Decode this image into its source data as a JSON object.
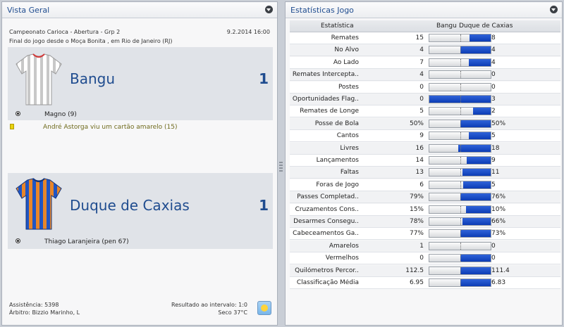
{
  "overview": {
    "title": "Vista Geral",
    "competition": "Campeonato Carioca - Abertura - Grp 2",
    "datetime": "9.2.2014 16:00",
    "venue": "Final do jogo desde o Moça Bonita , em Rio de Janeiro (RJ)",
    "home": {
      "name": "Bangu",
      "score": "1",
      "kit_colors": [
        "#ffffff",
        "#c9c9c9"
      ],
      "events": [
        {
          "icon": "ball-icon",
          "text": "Magno (9)"
        },
        {
          "icon": "yellow-card-icon",
          "text": "André Astorga viu um cartão amarelo (15)"
        }
      ]
    },
    "away": {
      "name": "Duque de Caxias",
      "score": "1",
      "kit_colors": [
        "#1f55c4",
        "#e8862a"
      ],
      "events": [
        {
          "icon": "ball-icon",
          "text": "Thiago Laranjeira (pen 67)"
        }
      ]
    },
    "attendance": "Assistência: 5398",
    "referee": "Árbitro: Bizzio Marinho, L",
    "halftime": "Resultado ao intervalo: 1:0",
    "weather": "Seco 37°C"
  },
  "stats": {
    "title": "Estatísticas Jogo",
    "col_stat": "Estatística",
    "col_home": "Bangu",
    "col_away": "Duque de Caxias",
    "rows": [
      {
        "label": "Remates",
        "home": "15",
        "away": "8",
        "home_share": 0.65
      },
      {
        "label": "No Alvo",
        "home": "4",
        "away": "4",
        "home_share": 0.5
      },
      {
        "label": "Ao Lado",
        "home": "7",
        "away": "4",
        "home_share": 0.64
      },
      {
        "label": "Remates Intercepta..",
        "home": "4",
        "away": "0",
        "home_share": 1.0
      },
      {
        "label": "Postes",
        "home": "0",
        "away": "0",
        "home_share": 1.0
      },
      {
        "label": "Oportunidades Flag..",
        "home": "0",
        "away": "3",
        "home_share": 0.0
      },
      {
        "label": "Remates de Longe",
        "home": "5",
        "away": "2",
        "home_share": 0.71
      },
      {
        "label": "Posse de Bola",
        "home": "50%",
        "away": "50%",
        "home_share": 0.5
      },
      {
        "label": "Cantos",
        "home": "9",
        "away": "5",
        "home_share": 0.64
      },
      {
        "label": "Livres",
        "home": "16",
        "away": "18",
        "home_share": 0.47
      },
      {
        "label": "Lançamentos",
        "home": "14",
        "away": "9",
        "home_share": 0.61
      },
      {
        "label": "Faltas",
        "home": "13",
        "away": "11",
        "home_share": 0.54
      },
      {
        "label": "Foras de Jogo",
        "home": "6",
        "away": "5",
        "home_share": 0.55
      },
      {
        "label": "Passes Completad..",
        "home": "79%",
        "away": "76%",
        "home_share": 0.51
      },
      {
        "label": "Cruzamentos Cons..",
        "home": "15%",
        "away": "10%",
        "home_share": 0.6
      },
      {
        "label": "Desarmes Consegu..",
        "home": "78%",
        "away": "66%",
        "home_share": 0.54
      },
      {
        "label": "Cabeceamentos Ga..",
        "home": "77%",
        "away": "73%",
        "home_share": 0.51
      },
      {
        "label": "Amarelos",
        "home": "1",
        "away": "0",
        "home_share": 1.0
      },
      {
        "label": "Vermelhos",
        "home": "0",
        "away": "0",
        "home_share": 0.5
      },
      {
        "label": "Quilómetros Percor..",
        "home": "112.5",
        "away": "111.4",
        "home_share": 0.5
      },
      {
        "label": "Classificação Média",
        "home": "6.95",
        "away": "6.83",
        "home_share": 0.5
      }
    ]
  }
}
